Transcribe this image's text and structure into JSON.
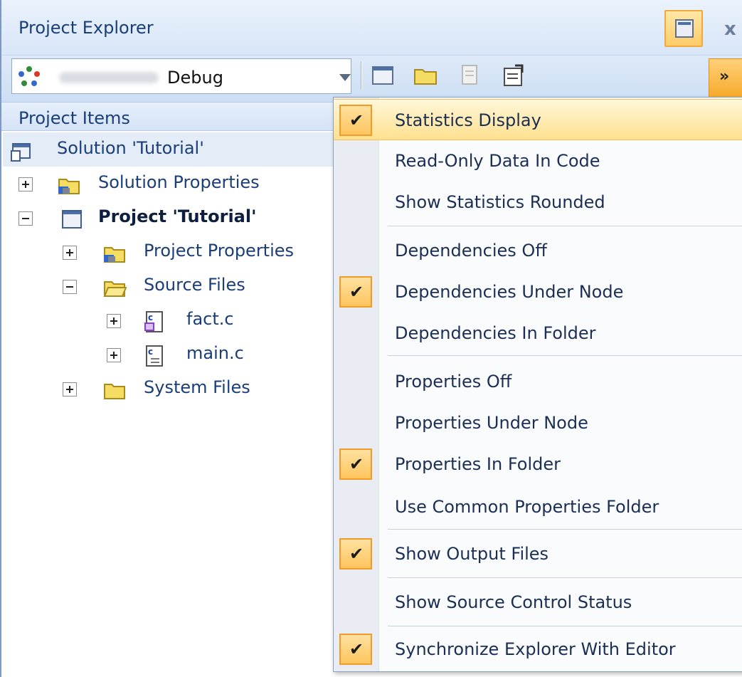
{
  "window": {
    "title": "Project Explorer"
  },
  "toolbar": {
    "configuration_value": "Debug",
    "icons": [
      "new-window-icon",
      "folder-icon",
      "disabled-doc-icon",
      "properties-icon"
    ]
  },
  "tree": {
    "header": "Project Items",
    "items": [
      {
        "label": "Solution 'Tutorial'",
        "icon": "solution-icon"
      },
      {
        "label": "Solution Properties",
        "icon": "properties-folder-icon"
      },
      {
        "label": "Project 'Tutorial'",
        "icon": "project-icon"
      },
      {
        "label": "Project Properties",
        "icon": "properties-folder-icon"
      },
      {
        "label": "Source Files",
        "icon": "open-folder-icon"
      },
      {
        "label": "fact.c",
        "icon": "c-file-icon"
      },
      {
        "label": "main.c",
        "icon": "c-file-icon"
      },
      {
        "label": "System Files",
        "icon": "folder-icon"
      }
    ]
  },
  "menu": {
    "items": [
      {
        "label": "Statistics Display",
        "checked": true
      },
      {
        "label": "Read-Only Data In Code",
        "checked": false
      },
      {
        "label": "Show Statistics Rounded",
        "checked": false
      },
      {
        "label": "Dependencies Off",
        "checked": false
      },
      {
        "label": "Dependencies Under Node",
        "checked": true
      },
      {
        "label": "Dependencies In Folder",
        "checked": false
      },
      {
        "label": "Properties Off",
        "checked": false
      },
      {
        "label": "Properties Under Node",
        "checked": false
      },
      {
        "label": "Properties In Folder",
        "checked": true
      },
      {
        "label": "Use Common Properties Folder",
        "checked": false
      },
      {
        "label": "Show Output Files",
        "checked": true
      },
      {
        "label": "Show Source Control Status",
        "checked": false
      },
      {
        "label": "Synchronize Explorer With Editor",
        "checked": true
      }
    ],
    "check_glyph": "✔",
    "highlight_color": "#ffe08e",
    "check_color": "#ffc55e"
  },
  "overflow_glyph": "»"
}
